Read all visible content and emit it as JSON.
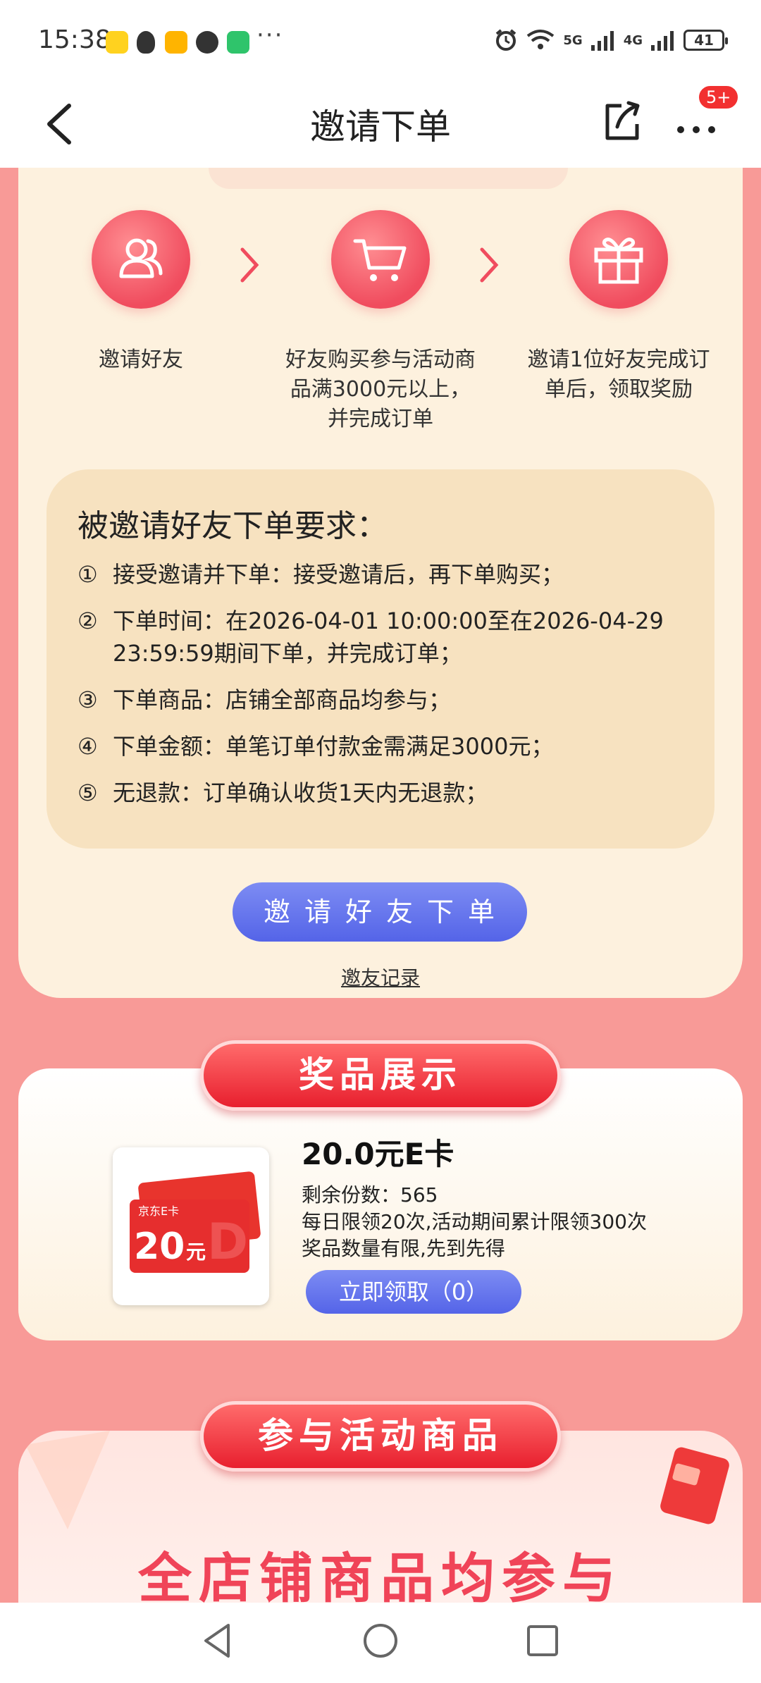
{
  "status_bar": {
    "time": "15:38",
    "more": "···",
    "network_1": "5G",
    "network_2": "4G",
    "battery": "41"
  },
  "header": {
    "title": "邀请下单",
    "badge": "5+"
  },
  "steps": [
    {
      "icon": "users-icon",
      "label": "邀请好友"
    },
    {
      "icon": "cart-icon",
      "label": "好友购买参与活动商品满3000元以上，并完成订单"
    },
    {
      "icon": "gift-icon",
      "label": "邀请1位好友完成订单后，领取奖励"
    }
  ],
  "requirements": {
    "title": "被邀请好友下单要求：",
    "items": [
      {
        "num": "①",
        "text": "接受邀请并下单：接受邀请后，再下单购买；"
      },
      {
        "num": "②",
        "text": "下单时间：在2026-04-01 10:00:00至在2026-04-29 23:59:59期间下单，并完成订单；"
      },
      {
        "num": "③",
        "text": "下单商品：店铺全部商品均参与；"
      },
      {
        "num": "④",
        "text": "下单金额：单笔订单付款金需满足3000元；"
      },
      {
        "num": "⑤",
        "text": "无退款：订单确认收货1天内无退款；"
      }
    ]
  },
  "invite_button": "邀请好友下单",
  "invite_record": "邀友记录",
  "prize_section": {
    "banner": "奖品展示",
    "card_brand": "京东E卡",
    "card_amount": "20",
    "card_unit": "元",
    "name": "20.0元E卡",
    "remaining": "剩余份数：565",
    "limit": "每日限领20次,活动期间累计限领300次",
    "note": "奖品数量有限,先到先得",
    "claim_button": "立即领取（0）"
  },
  "products_section": {
    "banner": "参与活动商品",
    "headline": "全店铺商品均参与"
  },
  "colors": {
    "page_bg": "#f89a97",
    "card_bg": "#fdf1de",
    "req_bg": "#f7e2c0",
    "accent_red": "#f04c5e",
    "button_blue": "#5a6aea"
  }
}
